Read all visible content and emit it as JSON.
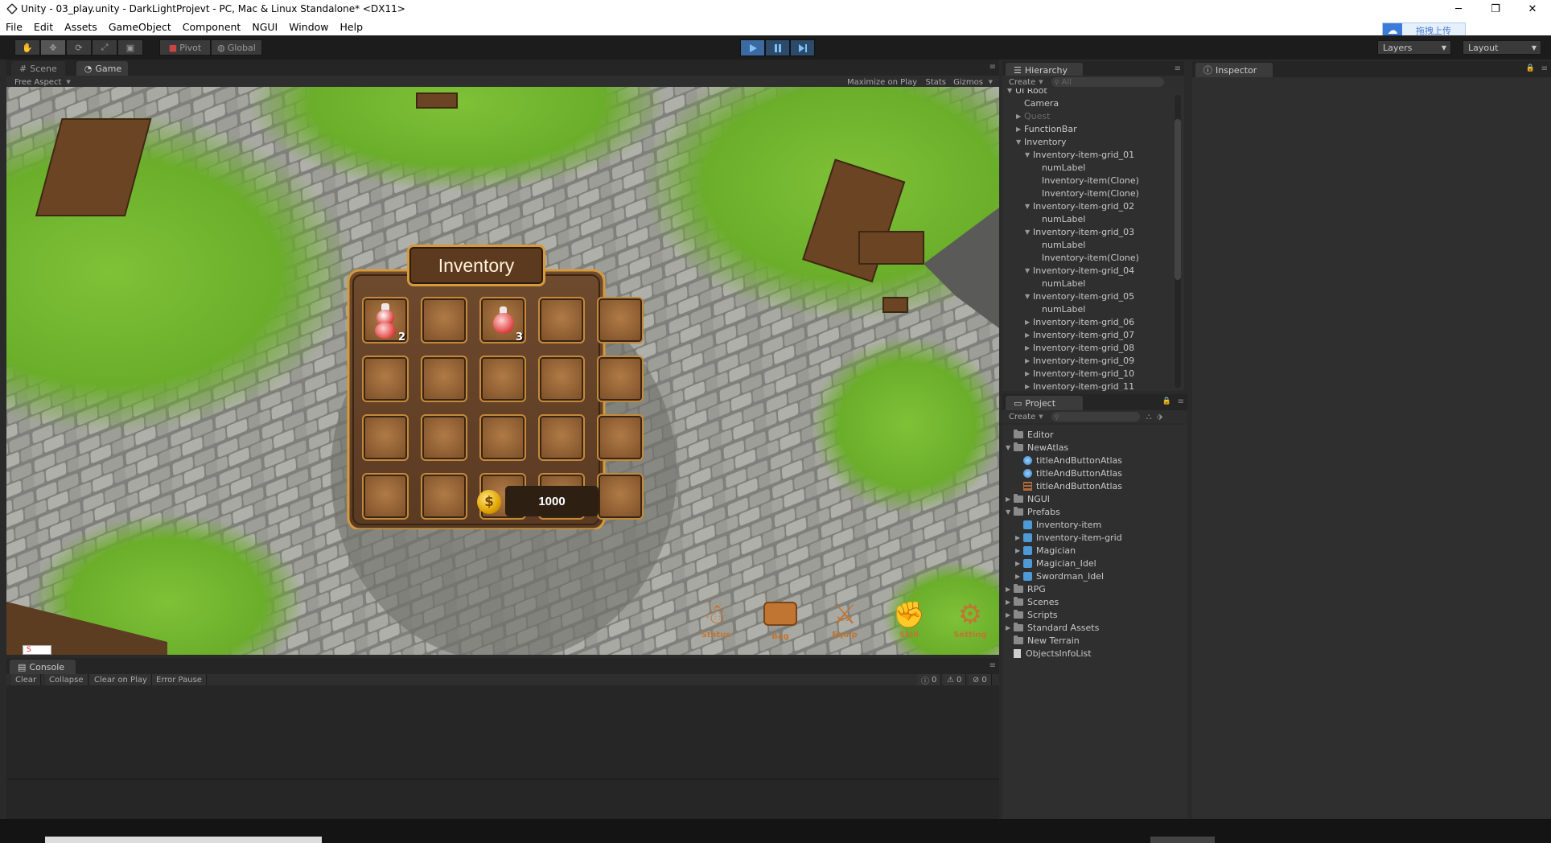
{
  "window": {
    "title": "Unity - 03_play.unity - DarkLightProjevt - PC, Mac & Linux Standalone* <DX11>",
    "minimize": "─",
    "restore": "❐",
    "close": "✕"
  },
  "menu": [
    "File",
    "Edit",
    "Assets",
    "GameObject",
    "Component",
    "NGUI",
    "Window",
    "Help"
  ],
  "upload_button": "拖拽上传",
  "toolbar": {
    "pivot": "Pivot",
    "global": "Global",
    "layers": "Layers",
    "layout": "Layout"
  },
  "scene_tabs": {
    "scene": "Scene",
    "game": "Game",
    "aspect": "Free Aspect",
    "maximize": "Maximize on Play",
    "stats": "Stats",
    "gizmos": "Gizmos"
  },
  "game_ui": {
    "inventory_title": "Inventory",
    "slot1_count": "2",
    "slot3_count": "3",
    "coins": "1000",
    "bottom_buttons": [
      "Status",
      "Bag",
      "Equip",
      "Skill",
      "Setting"
    ]
  },
  "hierarchy": {
    "tab": "Hierarchy",
    "create": "Create",
    "search_placeholder": "All",
    "items": [
      {
        "label": "UI Root",
        "indent": 0,
        "arrow": "▼",
        "dim": false
      },
      {
        "label": "Camera",
        "indent": 1,
        "arrow": "",
        "dim": false
      },
      {
        "label": "Quest",
        "indent": 1,
        "arrow": "▶",
        "dim": true
      },
      {
        "label": "FunctionBar",
        "indent": 1,
        "arrow": "▶",
        "dim": false
      },
      {
        "label": "Inventory",
        "indent": 1,
        "arrow": "▼",
        "dim": false
      },
      {
        "label": "Inventory-item-grid_01",
        "indent": 2,
        "arrow": "▼",
        "dim": false
      },
      {
        "label": "numLabel",
        "indent": 3,
        "arrow": "",
        "dim": false
      },
      {
        "label": "Inventory-item(Clone)",
        "indent": 3,
        "arrow": "",
        "dim": false
      },
      {
        "label": "Inventory-item(Clone)",
        "indent": 3,
        "arrow": "",
        "dim": false
      },
      {
        "label": "Inventory-item-grid_02",
        "indent": 2,
        "arrow": "▼",
        "dim": false
      },
      {
        "label": "numLabel",
        "indent": 3,
        "arrow": "",
        "dim": false
      },
      {
        "label": "Inventory-item-grid_03",
        "indent": 2,
        "arrow": "▼",
        "dim": false
      },
      {
        "label": "numLabel",
        "indent": 3,
        "arrow": "",
        "dim": false
      },
      {
        "label": "Inventory-item(Clone)",
        "indent": 3,
        "arrow": "",
        "dim": false
      },
      {
        "label": "Inventory-item-grid_04",
        "indent": 2,
        "arrow": "▼",
        "dim": false
      },
      {
        "label": "numLabel",
        "indent": 3,
        "arrow": "",
        "dim": false
      },
      {
        "label": "Inventory-item-grid_05",
        "indent": 2,
        "arrow": "▼",
        "dim": false
      },
      {
        "label": "numLabel",
        "indent": 3,
        "arrow": "",
        "dim": false
      },
      {
        "label": "Inventory-item-grid_06",
        "indent": 2,
        "arrow": "▶",
        "dim": false
      },
      {
        "label": "Inventory-item-grid_07",
        "indent": 2,
        "arrow": "▶",
        "dim": false
      },
      {
        "label": "Inventory-item-grid_08",
        "indent": 2,
        "arrow": "▶",
        "dim": false
      },
      {
        "label": "Inventory-item-grid_09",
        "indent": 2,
        "arrow": "▶",
        "dim": false
      },
      {
        "label": "Inventory-item-grid_10",
        "indent": 2,
        "arrow": "▶",
        "dim": false
      },
      {
        "label": "Inventory-item-grid_11",
        "indent": 2,
        "arrow": "▶",
        "dim": false
      }
    ]
  },
  "project": {
    "tab": "Project",
    "create": "Create",
    "items": [
      {
        "label": "Editor",
        "indent": 0,
        "arrow": "",
        "icon": "folder"
      },
      {
        "label": "NewAtlas",
        "indent": 0,
        "arrow": "▼",
        "icon": "folder"
      },
      {
        "label": "titleAndButtonAtlas",
        "indent": 1,
        "arrow": "",
        "icon": "atlas"
      },
      {
        "label": "titleAndButtonAtlas",
        "indent": 1,
        "arrow": "",
        "icon": "atlas"
      },
      {
        "label": "titleAndButtonAtlas",
        "indent": 1,
        "arrow": "",
        "icon": "texture"
      },
      {
        "label": "NGUI",
        "indent": 0,
        "arrow": "▶",
        "icon": "folder"
      },
      {
        "label": "Prefabs",
        "indent": 0,
        "arrow": "▼",
        "icon": "folder"
      },
      {
        "label": "Inventory-item",
        "indent": 1,
        "arrow": "",
        "icon": "prefab"
      },
      {
        "label": "Inventory-item-grid",
        "indent": 1,
        "arrow": "▶",
        "icon": "prefab"
      },
      {
        "label": "Magician",
        "indent": 1,
        "arrow": "▶",
        "icon": "prefab"
      },
      {
        "label": "Magician_Idel",
        "indent": 1,
        "arrow": "▶",
        "icon": "prefab"
      },
      {
        "label": "Swordman_Idel",
        "indent": 1,
        "arrow": "▶",
        "icon": "prefab"
      },
      {
        "label": "RPG",
        "indent": 0,
        "arrow": "▶",
        "icon": "folder"
      },
      {
        "label": "Scenes",
        "indent": 0,
        "arrow": "▶",
        "icon": "folder"
      },
      {
        "label": "Scripts",
        "indent": 0,
        "arrow": "▶",
        "icon": "folder"
      },
      {
        "label": "Standard Assets",
        "indent": 0,
        "arrow": "▶",
        "icon": "folder"
      },
      {
        "label": "New Terrain",
        "indent": 0,
        "arrow": "",
        "icon": "folder"
      },
      {
        "label": "ObjectsInfoList",
        "indent": 0,
        "arrow": "",
        "icon": "doc"
      }
    ]
  },
  "inspector": {
    "tab": "Inspector"
  },
  "console": {
    "tab": "Console",
    "buttons": [
      "Clear",
      "Collapse",
      "Clear on Play",
      "Error Pause"
    ],
    "counts": {
      "info": "0",
      "warn": "0",
      "error": "0"
    }
  }
}
